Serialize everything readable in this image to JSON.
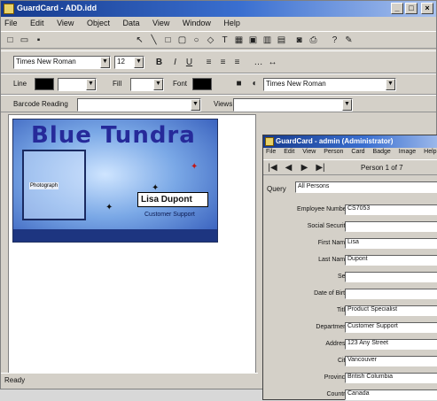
{
  "app": {
    "title": "GuardCard - ADD.idd",
    "window_buttons": [
      "_",
      "□",
      "×"
    ]
  },
  "menubar": [
    "File",
    "Edit",
    "View",
    "Object",
    "Data",
    "View",
    "Window",
    "Help"
  ],
  "toolbar2": {
    "font_family": "Times New Roman",
    "font_size": "12",
    "bold": "B",
    "italic": "I",
    "underline": "U"
  },
  "toolbar3": {
    "line_label": "Line",
    "fill_label": "Fill",
    "font_label": "Font",
    "font_value": "Times New Roman"
  },
  "toolbar4": {
    "barcode_label": "Barcode Reading",
    "views_label": "Views"
  },
  "card": {
    "title": "Blue Tundra",
    "photo_label": "Photograph",
    "name": "Lisa Dupont",
    "dept": "Customer Support"
  },
  "status": {
    "text": "Ready"
  },
  "child": {
    "title": "GuardCard - admin (Administrator)",
    "menu": [
      "File",
      "Edit",
      "View",
      "Person",
      "Card",
      "Badge",
      "Image",
      "Help"
    ],
    "record": "Person 1 of 7",
    "query_label": "Query",
    "query_value": "All Persons",
    "fields": [
      {
        "label": "Employee Number",
        "value": "CS7053"
      },
      {
        "label": "Social Security",
        "value": ""
      },
      {
        "label": "First Name",
        "value": "Lisa"
      },
      {
        "label": "Last Name",
        "value": "Dupont"
      },
      {
        "label": "Sex",
        "value": ""
      },
      {
        "label": "Date of Birth",
        "value": ""
      },
      {
        "label": "Title",
        "value": "Product Specialist"
      },
      {
        "label": "Department",
        "value": "Customer Support"
      },
      {
        "label": "Address",
        "value": "123 Any Street"
      },
      {
        "label": "City",
        "value": "Vancouver"
      },
      {
        "label": "Province",
        "value": "British Columbia"
      },
      {
        "label": "Country",
        "value": "Canada"
      }
    ]
  },
  "colors": {
    "titlebar_start": "#163a8c",
    "titlebar_end": "#a9c2ee",
    "card_title": "#262a9a"
  }
}
